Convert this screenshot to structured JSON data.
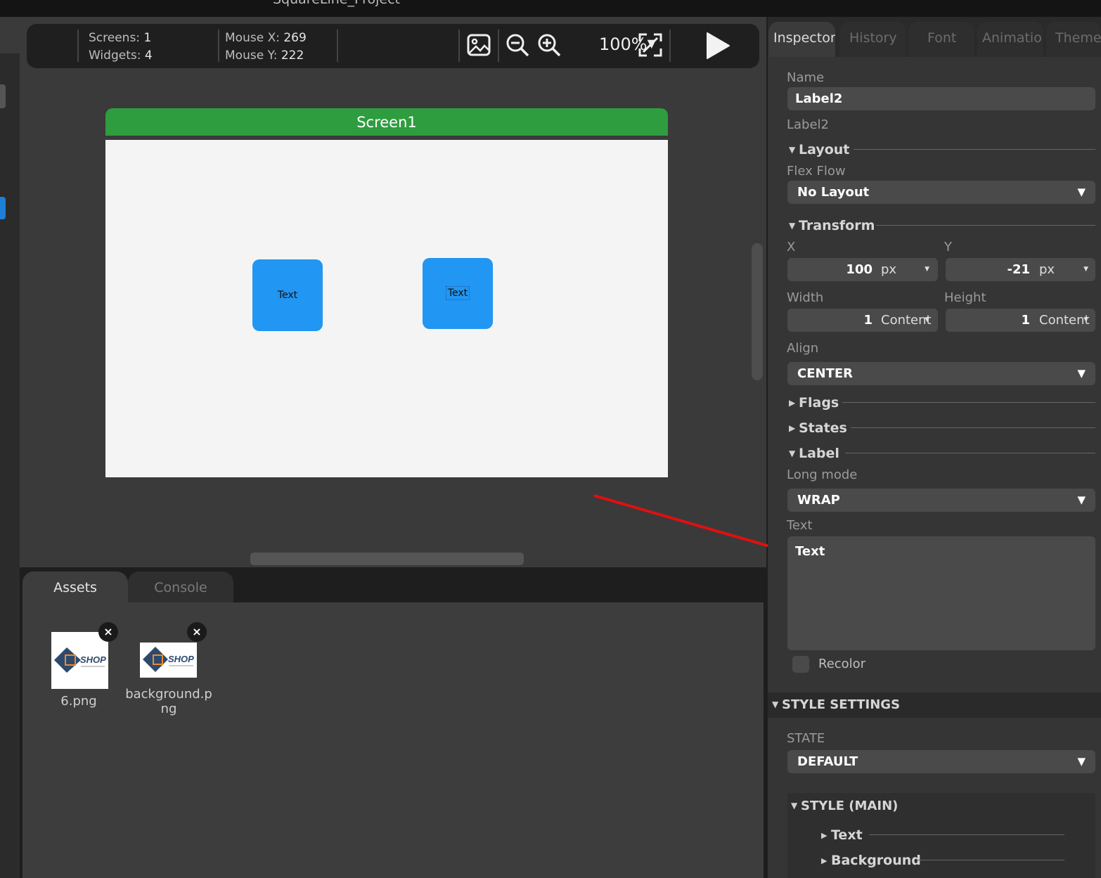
{
  "window": {
    "title": "SquareLine_Project"
  },
  "toolbar": {
    "screens_label": "Screens:",
    "screens_value": "1",
    "widgets_label": "Widgets:",
    "widgets_value": "4",
    "mouse_x_label": "Mouse X:",
    "mouse_x_value": "269",
    "mouse_y_label": "Mouse Y:",
    "mouse_y_value": "222",
    "zoom": "100%",
    "zoom_arrow": "▼",
    "play_icon": "play-icon"
  },
  "canvas": {
    "screen_title": "Screen1",
    "widgets": [
      {
        "label": "Text"
      },
      {
        "label": "Text"
      }
    ]
  },
  "bottom": {
    "tabs": [
      {
        "label": "Assets"
      },
      {
        "label": "Console"
      }
    ],
    "assets": [
      {
        "name": "6.png",
        "logo_text": "SHOP"
      },
      {
        "name": "background.png",
        "name_line1": "background.p",
        "name_line2": "ng",
        "logo_text": "SHOP"
      }
    ],
    "remove_glyph": "×"
  },
  "inspector": {
    "tabs": [
      {
        "label": "Inspector"
      },
      {
        "label": "History"
      },
      {
        "label": "Font"
      },
      {
        "label": "Animatio"
      },
      {
        "label": "Theme"
      }
    ],
    "name_label": "Name",
    "name_value": "Label2",
    "widget_type": "Label2",
    "layout": {
      "title": "Layout",
      "flex_flow_label": "Flex Flow",
      "flex_flow_value": "No Layout"
    },
    "transform": {
      "title": "Transform",
      "x_label": "X",
      "x_value": "100",
      "x_unit": "px",
      "y_label": "Y",
      "y_value": "-21",
      "y_unit": "px",
      "width_label": "Width",
      "width_value": "1",
      "width_unit": "Content",
      "height_label": "Height",
      "height_value": "1",
      "height_unit": "Content",
      "align_label": "Align",
      "align_value": "CENTER"
    },
    "flags": {
      "title": "Flags"
    },
    "states": {
      "title": "States"
    },
    "label": {
      "title": "Label",
      "long_mode_label": "Long mode",
      "long_mode_value": "WRAP",
      "text_label": "Text",
      "text_value": "Text",
      "recolor_label": "Recolor"
    },
    "style_settings": {
      "title": "STYLE SETTINGS",
      "state_label": "STATE",
      "state_value": "DEFAULT",
      "main_title": "STYLE (MAIN)",
      "items": [
        {
          "label": "Text"
        },
        {
          "label": "Background"
        }
      ]
    }
  },
  "colors": {
    "screen_header": "#2e9d3f",
    "widget": "#2196f3",
    "annotation_arrow": "#e01010"
  }
}
